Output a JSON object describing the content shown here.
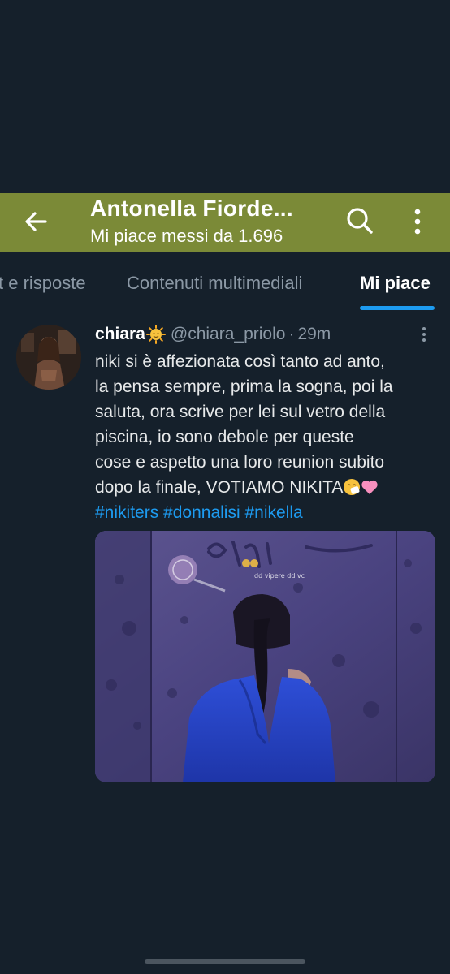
{
  "header": {
    "title": "Antonella Fiorde...",
    "subtitle": "Mi piace messi da 1.696",
    "header_color": "#7b8a37"
  },
  "tabs": [
    {
      "label": "t e risposte",
      "active": false
    },
    {
      "label": "Contenuti multimediali",
      "active": false
    },
    {
      "label": "Mi piace",
      "active": true
    }
  ],
  "tweet": {
    "name": "chiara",
    "name_emoji": "sun-with-face-icon",
    "handle": "@chiara_priolo",
    "separator": "·",
    "time": "29m",
    "text_lines": [
      "niki si è affezionata così tanto ad anto,",
      "la pensa sempre, prima la sogna, poi la",
      "saluta, ora scrive per lei sul vetro della",
      "piscina, io sono debole per queste",
      "cose e aspetto una loro reunion subito",
      "dopo la finale, VOTIAMO NIKITA"
    ],
    "text_end_emojis": [
      "sneezing-face-icon",
      "pink-heart-icon"
    ],
    "hashtags": [
      "#nikiters",
      "#donnalisi",
      "#nikella"
    ],
    "media": {
      "description_icon": "photo-of-woman-writing-on-glass",
      "watermark_caption": "dd vipere dd vc"
    }
  },
  "colors": {
    "background": "#15202b",
    "accent": "#1d9bf0",
    "muted_text": "#8b98a5"
  }
}
